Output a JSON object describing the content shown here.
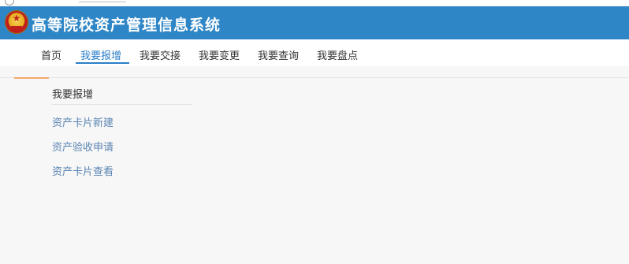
{
  "app": {
    "title": "高等院校资产管理信息系统"
  },
  "nav": {
    "items": [
      {
        "label": "首页"
      },
      {
        "label": "我要报增"
      },
      {
        "label": "我要交接"
      },
      {
        "label": "我要变更"
      },
      {
        "label": "我要查询"
      },
      {
        "label": "我要盘点"
      }
    ],
    "active": "我要报增"
  },
  "section": {
    "title": "我要报增",
    "links": [
      {
        "label": "资产卡片新建"
      },
      {
        "label": "资产验收申请"
      },
      {
        "label": "资产卡片查看"
      }
    ]
  },
  "icons": {
    "emblem": "national-emblem-icon"
  },
  "colors": {
    "header_bg": "#2f86c6",
    "nav_active": "#2a7ec9",
    "link": "#5b86b3",
    "accent": "#f3a96b"
  }
}
